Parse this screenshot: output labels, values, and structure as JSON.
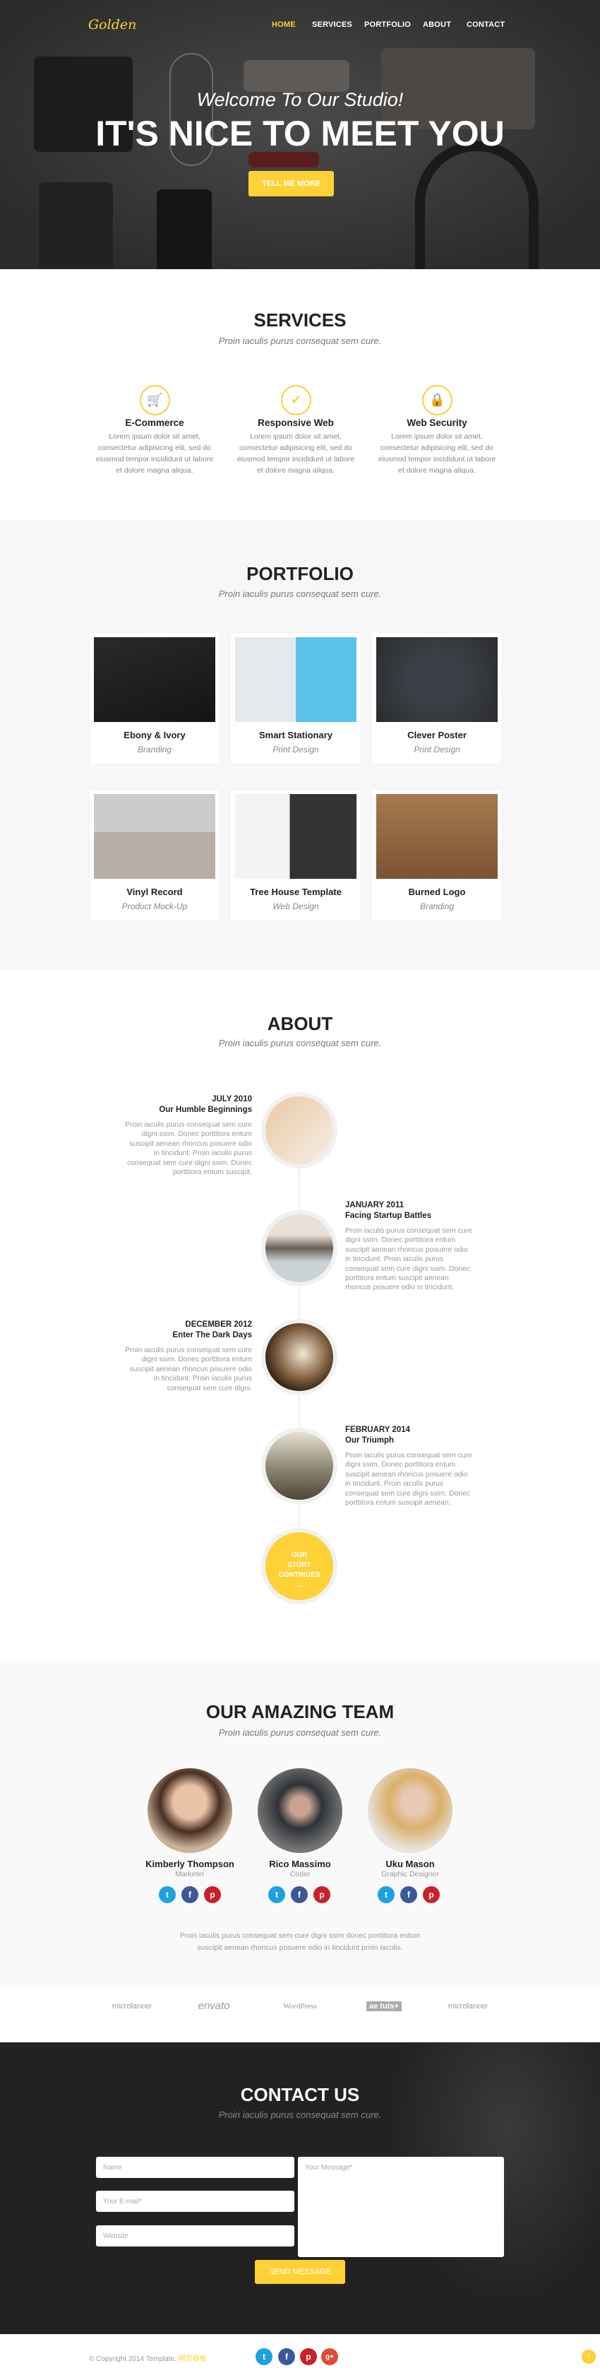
{
  "colors": {
    "accent": "#fed136",
    "dark": "#222222",
    "light_bg": "#f7f7f7"
  },
  "nav": {
    "logo": "Golden",
    "items": [
      {
        "label": "HOME",
        "active": true
      },
      {
        "label": "SERVICES"
      },
      {
        "label": "PORTFOLIO"
      },
      {
        "label": "ABOUT"
      },
      {
        "label": "CONTACT"
      }
    ]
  },
  "hero": {
    "welcome": "Welcome To Our Studio!",
    "headline": "IT'S NICE TO MEET YOU",
    "button": "TELL ME MORE"
  },
  "services": {
    "title": "SERVICES",
    "subtitle": "Proin iaculis purus consequat sem cure.",
    "items": [
      {
        "icon": "shopping-basket-icon",
        "title": "E-Commerce",
        "text": "Lorem ipsum dolor sit amet, consectetur adipisicing elit, sed do eiusmod tempor incididunt ut labore et dolore magna aliqua."
      },
      {
        "icon": "laptop-check-icon",
        "title": "Responsive Web",
        "text": "Lorem ipsum dolor sit amet, consectetur adipisicing elit, sed do eiusmod tempor incididunt ut labore et dolore magna aliqua."
      },
      {
        "icon": "lock-icon",
        "title": "Web Security",
        "text": "Lorem ipsum dolor sit amet, consectetur adipisicing elit, sed do eiusmod tempor incididunt ut labore et dolore magna aliqua."
      }
    ]
  },
  "portfolio": {
    "title": "PORTFOLIO",
    "subtitle": "Proin iaculis purus consequat sem cure.",
    "items": [
      {
        "title": "Ebony & Ivory",
        "category": "Branding"
      },
      {
        "title": "Smart Stationary",
        "category": "Print Design"
      },
      {
        "title": "Clever Poster",
        "category": "Print Design"
      },
      {
        "title": "Vinyl Record",
        "category": "Product Mock-Up"
      },
      {
        "title": "Tree House Template",
        "category": "Web Design"
      },
      {
        "title": "Burned Logo",
        "category": "Branding"
      }
    ]
  },
  "about": {
    "title": "ABOUT",
    "subtitle": "Proin iaculis purus consequat sem cure.",
    "timeline": [
      {
        "date": "JULY 2010",
        "heading": "Our Humble Beginnings",
        "text": "Proin iaculis purus consequat sem cure digni ssim. Donec porttitora entum suscipit aenean rhoncus posuere odio in tincidunt. Proin iaculis purus consequat sem cure digni ssim. Donec porttitora entum suscipit."
      },
      {
        "date": "JANUARY 2011",
        "heading": "Facing Startup Battles",
        "text": "Proin iaculis purus consequat sem cure digni ssim. Donec porttitora entum suscipit aenean rhoncus posuere odio in tincidunt. Proin iaculis purus consequat sem cure digni ssim. Donec porttitora entum suscipit aenean rhoncus posuere odio in tincidunt."
      },
      {
        "date": "DECEMBER 2012",
        "heading": "Enter The Dark Days",
        "text": "Proin iaculis purus consequat sem cure digni ssim. Donec porttitora entum suscipit aenean rhoncus posuere odio in tincidunt. Proin iaculis purus consequat sem cure digni."
      },
      {
        "date": "FEBRUARY 2014",
        "heading": "Our Triumph",
        "text": "Proin iaculis purus consequat sem cure digni ssim. Donec porttitora entum suscipit aenean rhoncus posuere odio in tincidunt. Proin iaculis purus consequat sem cure digni ssim. Donec porttitora entum suscipit aenean."
      }
    ],
    "end": [
      "OUR",
      "STORY",
      "CONTINUES",
      "..."
    ]
  },
  "team": {
    "title": "OUR AMAZING TEAM",
    "subtitle": "Proin iaculis purus consequat sem cure.",
    "members": [
      {
        "name": "Kimberly Thompson",
        "role": "Marketer"
      },
      {
        "name": "Rico Massimo",
        "role": "Coder"
      },
      {
        "name": "Uku Mason",
        "role": "Graphic Designer"
      }
    ],
    "text": "Proin iaculis purus consequat sem cure digni ssim donec porttitora entum suscipit aenean rhoncus posuere odio in tincidunt proin iaculis."
  },
  "clients": [
    "microlancer",
    "envato",
    "WordPress",
    "ae tuts+",
    "microlancer"
  ],
  "contact": {
    "title": "CONTACT US",
    "subtitle": "Proin iaculis purus consequat sem cure.",
    "name_placeholder": "Name",
    "email_placeholder": "Your E-mail*",
    "website_placeholder": "Website",
    "message_placeholder": "Your Message*",
    "button": "SEND MESSAGE"
  },
  "footer": {
    "copyright": "© Copyright 2014 Template.",
    "link": "网页模板",
    "social": [
      "twitter",
      "facebook",
      "pinterest",
      "google-plus"
    ]
  }
}
